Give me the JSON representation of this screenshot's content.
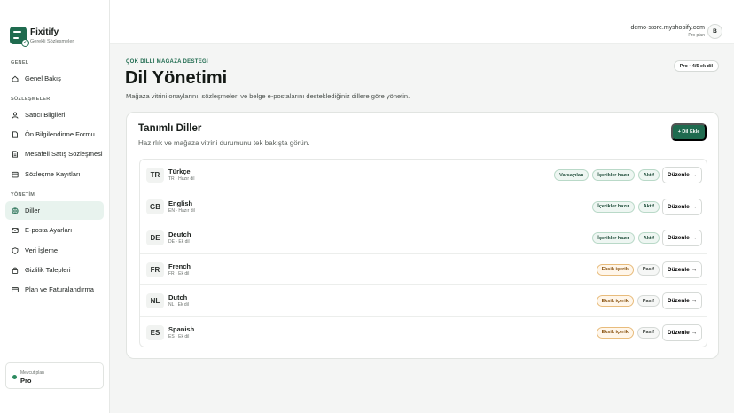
{
  "brand": {
    "name": "Fixitify",
    "subtitle": "Gerekli Sözleşmeler"
  },
  "sidebar": {
    "sections": [
      {
        "label": "GENEL"
      },
      {
        "label": "SÖZLEŞMELER"
      },
      {
        "label": "YÖNETİM"
      }
    ],
    "items": [
      {
        "label": "Genel Bakış",
        "icon": "home-icon"
      },
      {
        "label": "Satıcı Bilgileri",
        "icon": "user-icon"
      },
      {
        "label": "Ön Bilgilendirme Formu",
        "icon": "document-icon"
      },
      {
        "label": "Mesafeli Satış Sözleşmesi",
        "icon": "document-icon"
      },
      {
        "label": "Sözleşme Kayıtları",
        "icon": "archive-icon"
      },
      {
        "label": "Diller",
        "icon": "globe-icon",
        "active": true
      },
      {
        "label": "E-posta Ayarları",
        "icon": "mail-icon"
      },
      {
        "label": "Veri İşleme",
        "icon": "shield-icon"
      },
      {
        "label": "Gizlilik Talepleri",
        "icon": "lock-icon"
      },
      {
        "label": "Plan ve Faturalandırma",
        "icon": "card-icon"
      }
    ],
    "plan": {
      "label": "Mevcut plan",
      "value": "Pro"
    }
  },
  "topbar": {
    "store": "demo-store.myshopify.com",
    "plan": "Pro plan",
    "avatar": "B"
  },
  "page": {
    "eyebrow": "ÇOK DİLLİ MAĞAZA DESTEĞİ",
    "title": "Dil Yönetimi",
    "description": "Mağaza vitrini onaylarını, sözleşmeleri ve belge e-postalarını desteklediğiniz dillere göre yönetin.",
    "quota": "Pro · 4/5 ek dil"
  },
  "card": {
    "title": "Tanımlı Diller",
    "subtitle": "Hazırlık ve mağaza vitrini durumunu tek bakışta görün.",
    "add_label": "+ Dil Ekle",
    "edit_label": "Düzenle →"
  },
  "languages": [
    {
      "code": "TR",
      "name": "Türkçe",
      "meta": "TR · Hazır dil",
      "badges": [
        {
          "text": "Varsayılan",
          "tone": "green"
        },
        {
          "text": "İçerikler hazır",
          "tone": "green"
        },
        {
          "text": "Aktif",
          "tone": "green"
        }
      ]
    },
    {
      "code": "GB",
      "name": "English",
      "meta": "EN · Hazır dil",
      "badges": [
        {
          "text": "İçerikler hazır",
          "tone": "green"
        },
        {
          "text": "Aktif",
          "tone": "green"
        }
      ]
    },
    {
      "code": "DE",
      "name": "Deutch",
      "meta": "DE · Ek dil",
      "badges": [
        {
          "text": "İçerikler hazır",
          "tone": "green"
        },
        {
          "text": "Aktif",
          "tone": "green"
        }
      ]
    },
    {
      "code": "FR",
      "name": "French",
      "meta": "FR · Ek dil",
      "badges": [
        {
          "text": "Eksik içerik",
          "tone": "orange"
        },
        {
          "text": "Pasif",
          "tone": "gray"
        }
      ]
    },
    {
      "code": "NL",
      "name": "Dutch",
      "meta": "NL · Ek dil",
      "badges": [
        {
          "text": "Eksik içerik",
          "tone": "orange"
        },
        {
          "text": "Pasif",
          "tone": "gray"
        }
      ]
    },
    {
      "code": "ES",
      "name": "Spanish",
      "meta": "ES · Ek dil",
      "badges": [
        {
          "text": "Eksik içerik",
          "tone": "orange"
        },
        {
          "text": "Pasif",
          "tone": "gray"
        }
      ]
    }
  ],
  "colors": {
    "accent": "#1f6b4f",
    "active_bg": "#e8f3ee",
    "warning": "#e8bc7c"
  }
}
